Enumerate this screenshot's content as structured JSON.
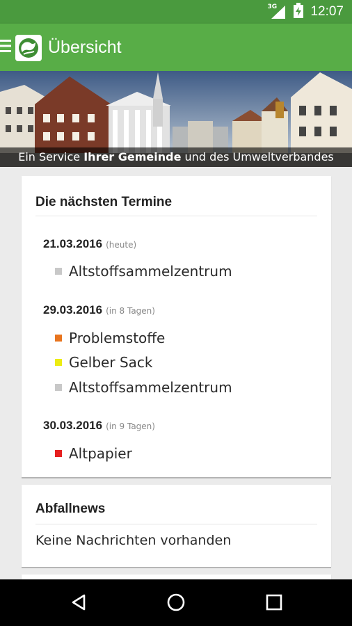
{
  "status_bar": {
    "network_type": "3G",
    "time": "12:07",
    "icons": [
      "signal-icon",
      "battery-charging-icon"
    ]
  },
  "app_bar": {
    "title": "Übersicht",
    "color": "#58ad47",
    "icons": [
      "menu-icon",
      "app-logo-icon"
    ]
  },
  "banner": {
    "caption_pre": "Ein Service ",
    "caption_bold": "Ihrer Gemeinde",
    "caption_post": " und des Umweltverbandes"
  },
  "appointments": {
    "title": "Die nächsten Termine",
    "groups": [
      {
        "date": "21.03.2016",
        "relative": "(heute)",
        "items": [
          {
            "label": "Altstoffsammelzentrum",
            "color": "#c8c8c8"
          }
        ]
      },
      {
        "date": "29.03.2016",
        "relative": "(in 8 Tagen)",
        "items": [
          {
            "label": "Problemstoffe",
            "color": "#e8741e"
          },
          {
            "label": "Gelber Sack",
            "color": "#ecec12"
          },
          {
            "label": "Altstoffsammelzentrum",
            "color": "#c8c8c8"
          }
        ]
      },
      {
        "date": "30.03.2016",
        "relative": "(in 9 Tagen)",
        "items": [
          {
            "label": "Altpapier",
            "color": "#e62020"
          }
        ]
      }
    ]
  },
  "news": {
    "title": "Abfallnews",
    "empty_text": "Keine Nachrichten vorhanden"
  },
  "nav_bar": {
    "buttons": [
      "back-icon",
      "home-icon",
      "recents-icon"
    ]
  }
}
